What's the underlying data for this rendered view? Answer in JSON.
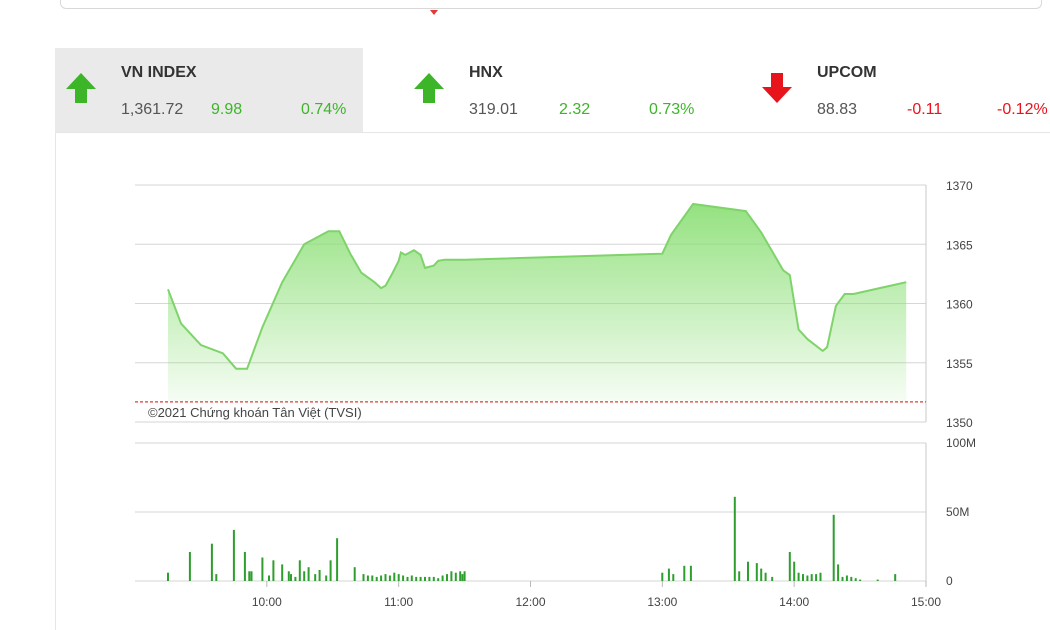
{
  "indices": [
    {
      "name": "VN INDEX",
      "value": "1,361.72",
      "change": "9.98",
      "pct": "0.74%",
      "direction": "up"
    },
    {
      "name": "HNX",
      "value": "319.01",
      "change": "2.32",
      "pct": "0.73%",
      "direction": "up"
    },
    {
      "name": "UPCOM",
      "value": "88.83",
      "change": "-0.11",
      "pct": "-0.12%",
      "direction": "down"
    }
  ],
  "colors": {
    "up": "#3cb528",
    "down": "#e8141c",
    "area_line": "#7fd36b",
    "volume_bar": "#2e9e2e",
    "reference_line": "#e53935"
  },
  "chart_data": [
    {
      "type": "area",
      "title": "",
      "annotation": "©2021 Chứng khoán Tân Việt (TVSI)",
      "x_ticks": [
        "10:00",
        "11:00",
        "12:00",
        "13:00",
        "14:00",
        "15:00"
      ],
      "y_ticks": [
        "1350",
        "1355",
        "1360",
        "1365",
        "1370"
      ],
      "ylim": [
        1350,
        1370
      ],
      "xlim": [
        "09:00",
        "15:00"
      ],
      "reference_value": 1351.7,
      "grid": true,
      "series": [
        {
          "x": [
            "09:15",
            "09:21",
            "09:30",
            "09:40",
            "09:46",
            "09:51",
            "09:52",
            "09:58",
            "10:07",
            "10:17",
            "10:28",
            "10:33",
            "10:38",
            "10:43",
            "10:49",
            "10:52",
            "10:54",
            "10:57",
            "11:00",
            "11:01",
            "11:03",
            "11:07",
            "11:10",
            "11:12",
            "11:16",
            "11:18",
            "11:21",
            "11:26",
            "11:30",
            "13:00",
            "13:04",
            "13:14",
            "13:38",
            "13:45",
            "13:55",
            "13:58",
            "14:02",
            "14:06",
            "14:13",
            "14:15",
            "14:19",
            "14:23",
            "14:27",
            "14:51"
          ],
          "y": [
            1361.2,
            1358.3,
            1356.5,
            1355.8,
            1354.5,
            1354.5,
            1355.0,
            1358.0,
            1361.8,
            1365.0,
            1366.1,
            1366.1,
            1364.2,
            1362.6,
            1361.8,
            1361.3,
            1361.5,
            1362.5,
            1363.6,
            1364.3,
            1364.1,
            1364.5,
            1364.1,
            1363.0,
            1363.2,
            1363.6,
            1363.7,
            1363.7,
            1363.7,
            1364.2,
            1365.8,
            1368.4,
            1367.8,
            1366.0,
            1362.8,
            1362.4,
            1357.8,
            1357.0,
            1356.0,
            1356.3,
            1359.8,
            1360.8,
            1360.8,
            1361.8
          ]
        }
      ]
    },
    {
      "type": "bar",
      "title": "",
      "x_ticks": [
        "10:00",
        "11:00",
        "12:00",
        "13:00",
        "14:00",
        "15:00"
      ],
      "y_ticks": [
        "0",
        "50M",
        "100M"
      ],
      "ylim": [
        0,
        100
      ],
      "unit": "M",
      "series": [
        {
          "x": [
            "09:15",
            "09:25",
            "09:35",
            "09:37",
            "09:45",
            "09:50",
            "09:52",
            "09:53",
            "09:58",
            "10:01",
            "10:03",
            "10:07",
            "10:10",
            "10:11",
            "10:13",
            "10:15",
            "10:17",
            "10:19",
            "10:22",
            "10:24",
            "10:27",
            "10:29",
            "10:32",
            "10:40",
            "10:44",
            "10:46",
            "10:48",
            "10:50",
            "10:52",
            "10:54",
            "10:56",
            "10:58",
            "11:00",
            "11:02",
            "11:04",
            "11:06",
            "11:08",
            "11:10",
            "11:12",
            "11:14",
            "11:16",
            "11:18",
            "11:20",
            "11:22",
            "11:24",
            "11:26",
            "11:28",
            "11:29",
            "11:30",
            "13:00",
            "13:03",
            "13:05",
            "13:10",
            "13:13",
            "13:33",
            "13:35",
            "13:39",
            "13:43",
            "13:45",
            "13:47",
            "13:50",
            "13:58",
            "14:00",
            "14:02",
            "14:04",
            "14:06",
            "14:08",
            "14:10",
            "14:12",
            "14:18",
            "14:20",
            "14:22",
            "14:24",
            "14:26",
            "14:28",
            "14:30",
            "14:38",
            "14:46"
          ],
          "y": [
            6,
            21,
            27,
            5,
            37,
            21,
            7,
            7,
            17,
            4,
            15,
            12,
            7,
            5,
            3,
            15,
            7,
            10,
            5,
            8,
            4,
            15,
            31,
            10,
            5,
            4,
            4,
            3,
            4,
            5,
            4,
            6,
            5,
            4,
            3,
            4,
            3,
            3,
            3,
            3,
            3,
            2,
            4,
            5,
            7,
            6,
            7,
            5,
            7,
            6,
            9,
            5,
            11,
            11,
            61,
            7,
            14,
            13,
            9,
            6,
            3,
            21,
            14,
            6,
            5,
            4,
            5,
            5,
            6,
            48,
            12,
            3,
            4,
            3,
            2,
            1,
            1,
            5
          ]
        }
      ]
    }
  ]
}
